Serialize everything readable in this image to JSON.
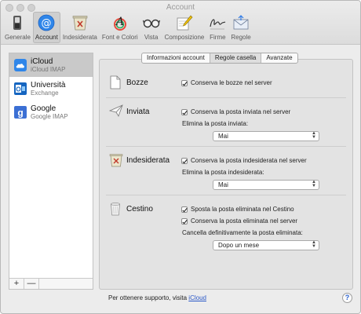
{
  "window": {
    "title": "Account"
  },
  "toolbar": {
    "items": [
      {
        "label": "Generale",
        "icon": "switch-icon"
      },
      {
        "label": "Account",
        "icon": "at-sign-icon"
      },
      {
        "label": "Indesiderata",
        "icon": "junk-trash-icon"
      },
      {
        "label": "Font e Colori",
        "icon": "font-colors-icon"
      },
      {
        "label": "Vista",
        "icon": "glasses-icon"
      },
      {
        "label": "Composizione",
        "icon": "compose-pencil-icon"
      },
      {
        "label": "Firme",
        "icon": "signature-icon"
      },
      {
        "label": "Regole",
        "icon": "rules-envelope-icon"
      }
    ],
    "active": "Account"
  },
  "sidebar": {
    "accounts": [
      {
        "name": "iCloud",
        "type": "iCloud IMAP",
        "icon": "icloud-icon"
      },
      {
        "name": "Università",
        "type": "Exchange",
        "icon": "exchange-icon"
      },
      {
        "name": "Google",
        "type": "Google IMAP",
        "icon": "google-icon"
      }
    ],
    "selected": "iCloud",
    "add_label": "+",
    "remove_label": "—"
  },
  "tabs": {
    "items": [
      "Informazioni account",
      "Regole casella",
      "Avanzate"
    ],
    "active": "Regole casella"
  },
  "sections": {
    "bozze": {
      "title": "Bozze",
      "icon": "draft-page-icon",
      "checkbox": "Conserva le bozze nel server",
      "checked": true
    },
    "inviata": {
      "title": "Inviata",
      "icon": "paper-plane-icon",
      "checkbox": "Conserva la posta inviata nel server",
      "checked": true,
      "select_label": "Elimina la posta inviata:",
      "select_value": "Mai"
    },
    "indesiderata": {
      "title": "Indesiderata",
      "icon": "junk-box-icon",
      "checkbox": "Conserva la posta indesiderata nel server",
      "checked": true,
      "select_label": "Elimina la posta indesiderata:",
      "select_value": "Mai"
    },
    "cestino": {
      "title": "Cestino",
      "icon": "trash-can-icon",
      "checkbox1": "Sposta la posta eliminata nel Cestino",
      "checkbox2": "Conserva la posta eliminata nel server",
      "checked": true,
      "select_label": "Cancella definitivamente la posta eliminata:",
      "select_value": "Dopo un mese"
    }
  },
  "footer": {
    "text": "Per ottenere supporto, visita",
    "link": "iCloud",
    "help": "?"
  },
  "colors": {
    "accent": "#2f7ae5",
    "link": "#2a58c8",
    "selected_row": "#c9c9c9"
  }
}
